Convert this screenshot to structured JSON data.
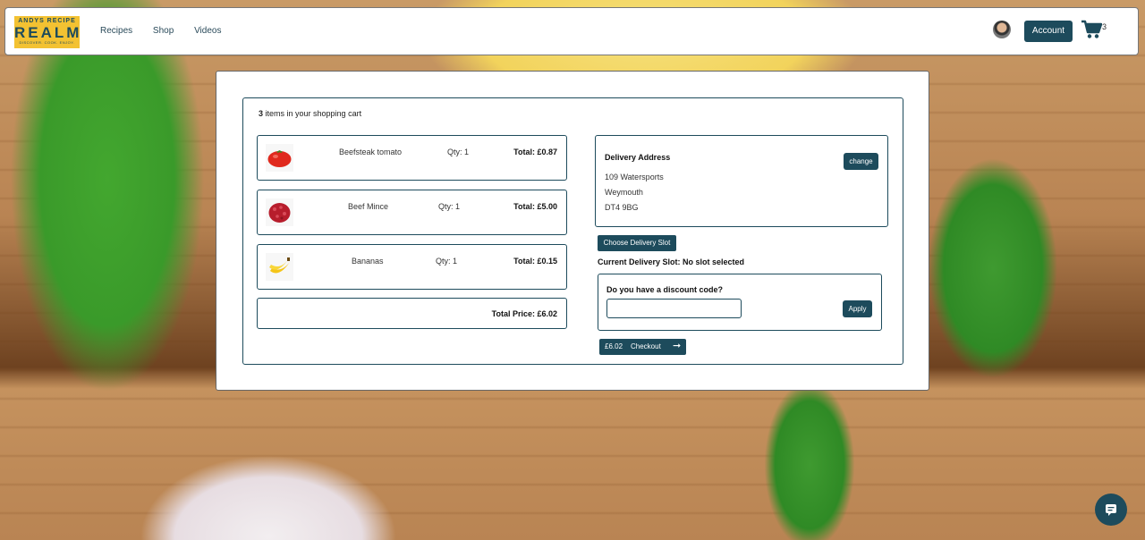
{
  "logo": {
    "line1": "ANDYS RECIPE",
    "line2": "REALM",
    "line3": "DISCOVER. COOK. ENJOY."
  },
  "nav": {
    "items": [
      "Recipes",
      "Shop",
      "Videos"
    ]
  },
  "header": {
    "account_label": "Account",
    "cart_count": "3"
  },
  "cart": {
    "count": "3",
    "summary_text": " items in your shopping cart",
    "items": [
      {
        "name": "Beefsteak tomato",
        "qty": "Qty: 1",
        "total": "Total: £0.87",
        "icon": "tomato-icon"
      },
      {
        "name": "Beef Mince",
        "qty": "Qty: 1",
        "total": "Total: £5.00",
        "icon": "mince-icon"
      },
      {
        "name": "Bananas",
        "qty": "Qty: 1",
        "total": "Total: £0.15",
        "icon": "banana-icon"
      }
    ],
    "total_price": "Total Price: £6.02"
  },
  "delivery": {
    "title": "Delivery Address",
    "change_label": "change",
    "line1": "109 Watersports",
    "line2": "Weymouth",
    "line3": "DT4 9BG",
    "slot_button": "Choose Delivery Slot",
    "current_slot": "Current Delivery Slot: No slot selected"
  },
  "discount": {
    "question": "Do you have a discount code?",
    "input_value": "",
    "placeholder": "",
    "apply_label": "Apply"
  },
  "checkout": {
    "price": "£6.02",
    "label": "Checkout"
  },
  "colors": {
    "primary": "#1d4b5c",
    "logo_bg": "#f3c232"
  }
}
